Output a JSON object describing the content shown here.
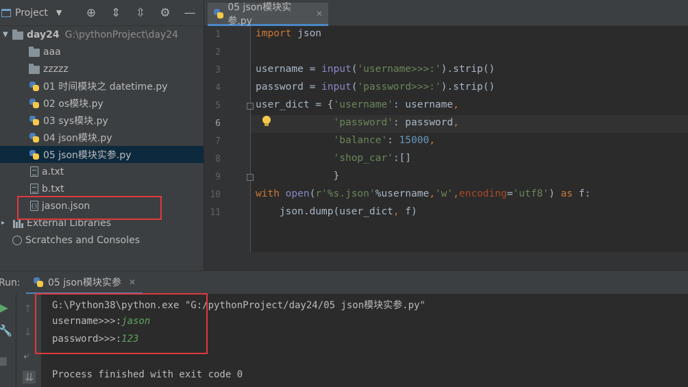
{
  "project_panel": {
    "title": "Project",
    "tree": [
      {
        "label": "day24",
        "path": "G:\\pythonProject\\day24",
        "type": "folder"
      },
      {
        "label": "aaa",
        "type": "folder"
      },
      {
        "label": "zzzzz",
        "type": "folder"
      },
      {
        "label": "01 时间模块之 datetime.py",
        "type": "python"
      },
      {
        "label": "02 os模块.py",
        "type": "python"
      },
      {
        "label": "03 sys模块.py",
        "type": "python"
      },
      {
        "label": "04 json模块.py",
        "type": "python"
      },
      {
        "label": "05 json模块实参.py",
        "type": "python",
        "selected": true
      },
      {
        "label": "a.txt",
        "type": "text"
      },
      {
        "label": "b.txt",
        "type": "text"
      },
      {
        "label": "jason.json",
        "type": "json"
      },
      {
        "label": "External Libraries",
        "type": "library"
      },
      {
        "label": "Scratches and Consoles",
        "type": "scratch"
      }
    ]
  },
  "editor": {
    "tab_label": "05 json模块实参.py",
    "line_numbers": [
      "1",
      "2",
      "3",
      "4",
      "5",
      "6",
      "7",
      "8",
      "9",
      "10",
      "11"
    ],
    "lines": [
      "import json",
      "",
      "username = input('username>>>:').strip()",
      "password = input('password>>>:').strip()",
      "user_dict = {'username': username,",
      "             'password': password,",
      "             'balance': 15000,",
      "             'shop_car':[]",
      "             }",
      "with open(r'%s.json'%username,'w',encoding='utf8') as f:",
      "    json.dump(user_dict, f)"
    ]
  },
  "run_panel": {
    "label": "Run:",
    "tab_label": "05 json模块实参",
    "output": {
      "command": "G:\\Python38\\python.exe \"G:/pythonProject/day24/05 json模块实参.py\"",
      "prompt1": "username>>>:",
      "input1": "jason",
      "prompt2": "password>>>:",
      "input2": "123",
      "finished": "Process finished with exit code 0"
    }
  },
  "colors": {
    "keyword": "#cc7832",
    "string": "#6a8759",
    "number": "#6897bb",
    "highlight_box": "#e0393e",
    "user_input": "#5ea35e"
  }
}
